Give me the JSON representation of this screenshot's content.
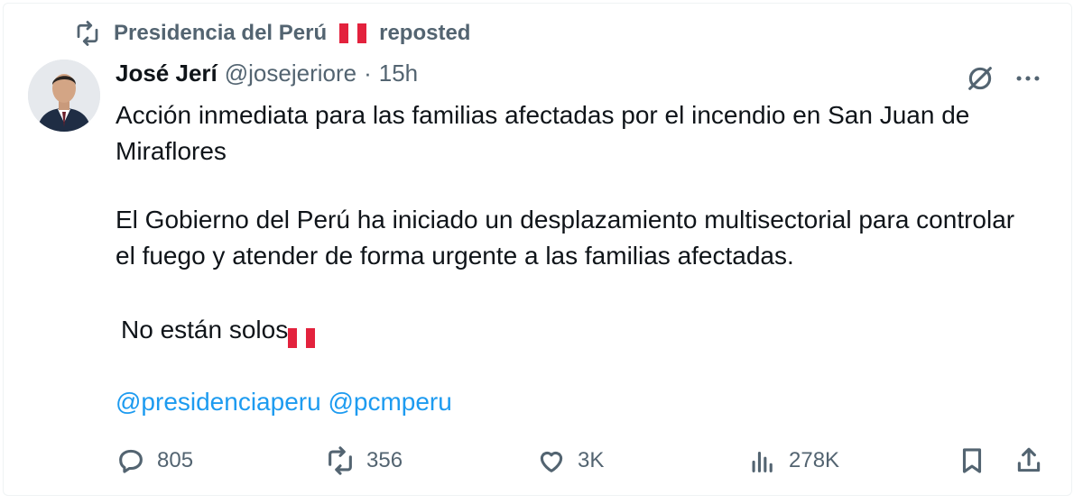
{
  "repost": {
    "account": "Presidencia del Perú",
    "label": "reposted"
  },
  "tweet": {
    "author_name": "José Jerí",
    "handle": "@josejeriore",
    "separator": "·",
    "time": "15h",
    "text_line1": "Acción inmediata para las familias afectadas por el incendio en San Juan de Miraflores",
    "text_line2": "El Gobierno del Perú ha iniciado un desplazamiento multisectorial para controlar el fuego y atender de forma urgente a las familias afectadas.",
    "text_line3": "No están solos",
    "mentions": [
      "@presidenciaperu",
      "@pcmperu"
    ]
  },
  "actions": {
    "replies": "805",
    "reposts": "356",
    "likes": "3K",
    "views": "278K"
  },
  "colors": {
    "text": "#0f1419",
    "muted": "#536471",
    "link": "#1d9bf0",
    "flag_red": "#e3223d"
  },
  "icons": [
    "repost-icon",
    "peru-flag-icon",
    "grok-icon",
    "more-icon",
    "reply-icon",
    "like-icon",
    "views-icon",
    "bookmark-icon",
    "share-icon"
  ]
}
